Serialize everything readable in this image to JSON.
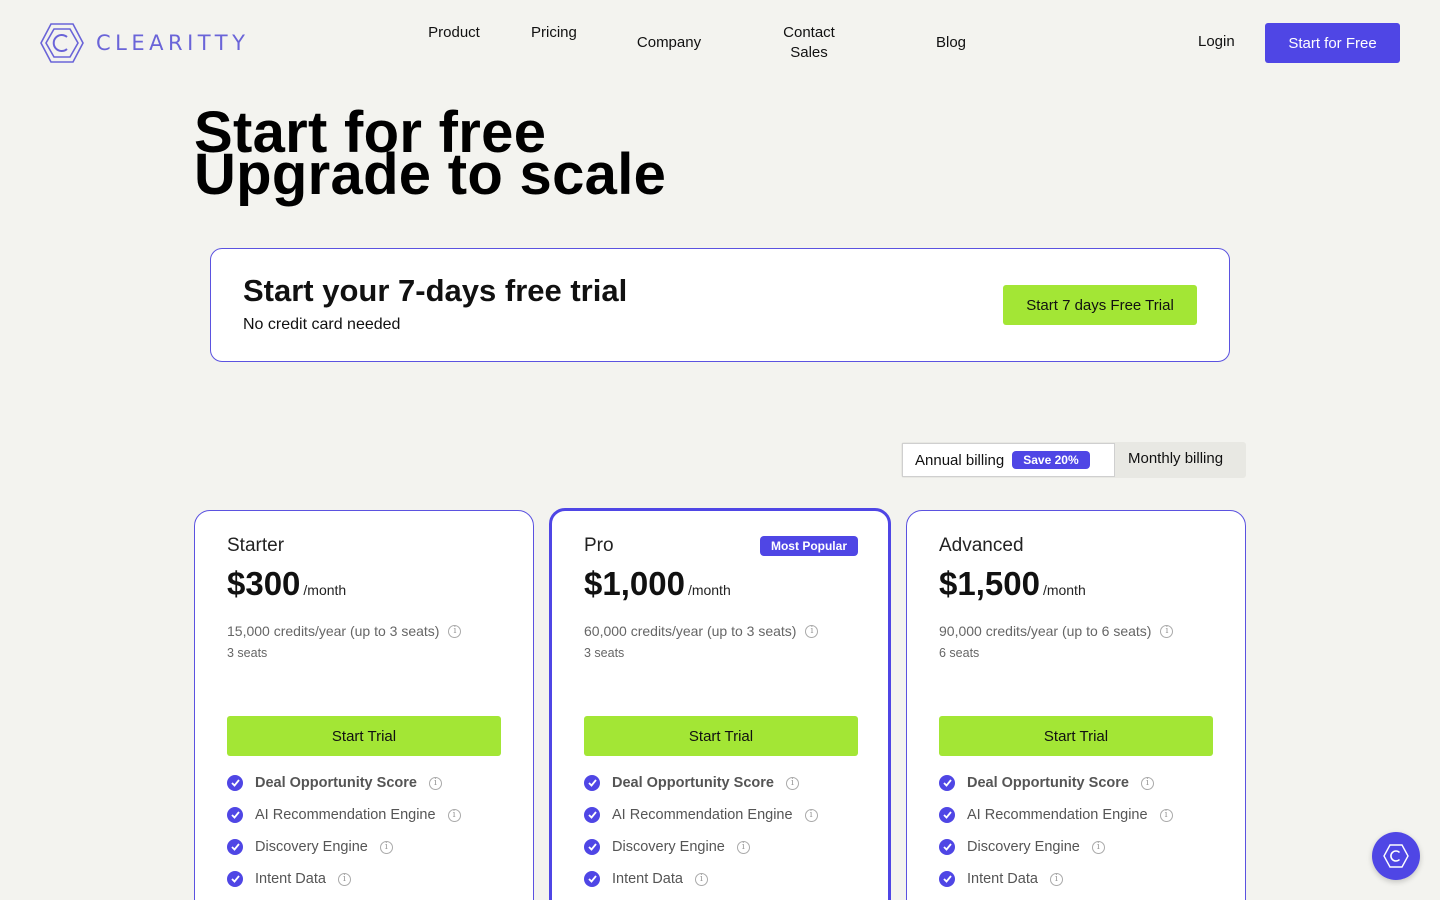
{
  "brand": {
    "name": "CLEARITTY",
    "accent": "#4f46e5",
    "green": "#a3e635"
  },
  "nav": {
    "items": [
      {
        "label": "Product"
      },
      {
        "label": "Pricing"
      },
      {
        "label": "Company"
      },
      {
        "label": "Contact Sales"
      },
      {
        "label": "Blog"
      }
    ],
    "login": "Login",
    "cta": "Start for Free"
  },
  "hero": {
    "line1": "Start for free",
    "line2": "Upgrade to scale"
  },
  "trial": {
    "title": "Start your 7-days free trial",
    "subtitle": "No credit card needed",
    "button": "Start 7 days Free Trial"
  },
  "billing": {
    "annual": "Annual billing",
    "save": "Save 20%",
    "monthly": "Monthly billing",
    "selected": "annual"
  },
  "plans": [
    {
      "name": "Starter",
      "price": "$300",
      "period": "/month",
      "credits": "15,000 credits/year (up to 3 seats)",
      "seats": "3 seats",
      "button": "Start Trial",
      "badge": ""
    },
    {
      "name": "Pro",
      "price": "$1,000",
      "period": "/month",
      "credits": "60,000 credits/year (up to 3 seats)",
      "seats": "3 seats",
      "button": "Start Trial",
      "badge": "Most Popular"
    },
    {
      "name": "Advanced",
      "price": "$1,500",
      "period": "/month",
      "credits": "90,000 credits/year (up to 6 seats)",
      "seats": "6 seats",
      "button": "Start Trial",
      "badge": ""
    }
  ],
  "features": [
    "Deal Opportunity Score",
    "AI Recommendation Engine",
    "Discovery Engine",
    "Intent Data"
  ],
  "icons": {
    "logo": "hexagon-c-logo-icon",
    "check": "check-circle-icon",
    "info": "info-icon",
    "chat": "chat-widget-icon"
  }
}
